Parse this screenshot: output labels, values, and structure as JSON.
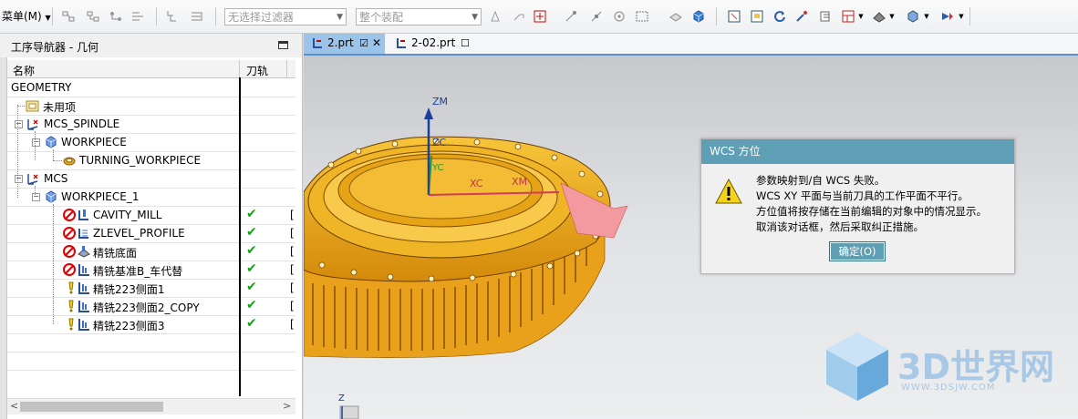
{
  "toolbar": {
    "menu_label": "菜单(M)",
    "filter_placeholder": "无选择过滤器",
    "scope_value": "整个装配"
  },
  "navigator": {
    "title": "工序导航器 - 几何",
    "columns": [
      "名称",
      "刀轨"
    ],
    "rows": [
      {
        "label": "GEOMETRY",
        "status": "",
        "check": ""
      },
      {
        "label": "未用项",
        "status": "",
        "check": ""
      },
      {
        "label": "MCS_SPINDLE",
        "status": "",
        "check": ""
      },
      {
        "label": "WORKPIECE",
        "status": "",
        "check": ""
      },
      {
        "label": "TURNING_WORKPIECE",
        "status": "",
        "check": ""
      },
      {
        "label": "MCS",
        "status": "",
        "check": ""
      },
      {
        "label": "WORKPIECE_1",
        "status": "",
        "check": ""
      },
      {
        "label": "CAVITY_MILL",
        "status": "blocked",
        "check": "✔"
      },
      {
        "label": "ZLEVEL_PROFILE",
        "status": "blocked",
        "check": "✔"
      },
      {
        "label": "精铣底面",
        "status": "blocked",
        "check": "✔"
      },
      {
        "label": "精铣基准B_车代替",
        "status": "blocked",
        "check": "✔"
      },
      {
        "label": "精铣223侧面1",
        "status": "warning",
        "check": "✔"
      },
      {
        "label": "精铣223侧面2_COPY",
        "status": "warning",
        "check": "✔"
      },
      {
        "label": "精铣223侧面3",
        "status": "warning",
        "check": "✔"
      }
    ]
  },
  "tabs": [
    {
      "label": "2.prt",
      "active": true
    },
    {
      "label": "2-02.prt",
      "active": false
    }
  ],
  "viewport": {
    "axis_labels": {
      "zm": "ZM",
      "zc": "ZC",
      "xc": "XC",
      "xm": "XM",
      "yc": "YC",
      "small_z": "Z"
    }
  },
  "dialog": {
    "title": "WCS 方位",
    "messages": [
      "参数映射到/自 WCS 失败。",
      "WCS XY 平面与当前刀具的工作平面不平行。",
      "方位值将按存储在当前编辑的对象中的情况显示。",
      "取消该对话框，然后采取纠正措施。"
    ],
    "ok_label": "确定(O)"
  },
  "watermark": {
    "brand": "3D世界网",
    "url": "WWW.3DSJW.COM"
  },
  "colors": {
    "dialog_title": "#5f9fb5",
    "part": "#f2b51b",
    "check": "#1aa01a",
    "blocked": "#e00000"
  }
}
